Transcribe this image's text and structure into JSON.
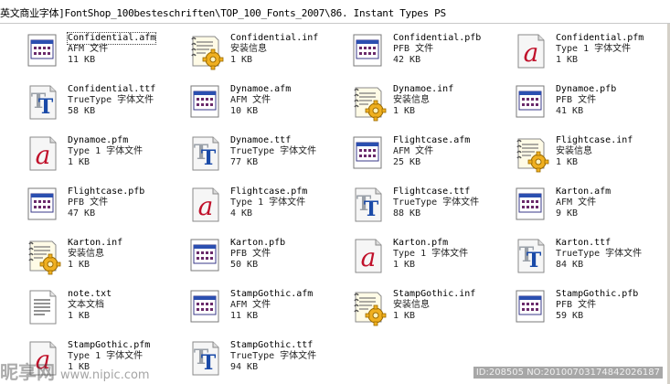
{
  "address": "英文商业字体]FontShop_100besteschriften\\TOP_100_Fonts_2007\\86. Instant Types PS",
  "files": [
    {
      "name": "Confidential.afm",
      "type": "AFM 文件",
      "size": "11 KB",
      "icon": "afm-file-icon"
    },
    {
      "name": "Confidential.inf",
      "type": "安装信息",
      "size": "1 KB",
      "icon": "setup-info-icon"
    },
    {
      "name": "Confidential.pfb",
      "type": "PFB 文件",
      "size": "42 KB",
      "icon": "pfb-file-icon"
    },
    {
      "name": "Confidential.pfm",
      "type": "Type 1 字体文件",
      "size": "1 KB",
      "icon": "type1-font-icon"
    },
    {
      "name": "Confidential.ttf",
      "type": "TrueType 字体文件",
      "size": "58 KB",
      "icon": "truetype-font-icon"
    },
    {
      "name": "Dynamoe.afm",
      "type": "AFM 文件",
      "size": "10 KB",
      "icon": "afm-file-icon"
    },
    {
      "name": "Dynamoe.inf",
      "type": "安装信息",
      "size": "1 KB",
      "icon": "setup-info-icon"
    },
    {
      "name": "Dynamoe.pfb",
      "type": "PFB 文件",
      "size": "41 KB",
      "icon": "pfb-file-icon"
    },
    {
      "name": "Dynamoe.pfm",
      "type": "Type 1 字体文件",
      "size": "1 KB",
      "icon": "type1-font-icon"
    },
    {
      "name": "Dynamoe.ttf",
      "type": "TrueType 字体文件",
      "size": "77 KB",
      "icon": "truetype-font-icon"
    },
    {
      "name": "Flightcase.afm",
      "type": "AFM 文件",
      "size": "25 KB",
      "icon": "afm-file-icon"
    },
    {
      "name": "Flightcase.inf",
      "type": "安装信息",
      "size": "1 KB",
      "icon": "setup-info-icon"
    },
    {
      "name": "Flightcase.pfb",
      "type": "PFB 文件",
      "size": "47 KB",
      "icon": "pfb-file-icon"
    },
    {
      "name": "Flightcase.pfm",
      "type": "Type 1 字体文件",
      "size": "4 KB",
      "icon": "type1-font-icon"
    },
    {
      "name": "Flightcase.ttf",
      "type": "TrueType 字体文件",
      "size": "88 KB",
      "icon": "truetype-font-icon"
    },
    {
      "name": "Karton.afm",
      "type": "AFM 文件",
      "size": "9 KB",
      "icon": "afm-file-icon"
    },
    {
      "name": "Karton.inf",
      "type": "安装信息",
      "size": "1 KB",
      "icon": "setup-info-icon"
    },
    {
      "name": "Karton.pfb",
      "type": "PFB 文件",
      "size": "50 KB",
      "icon": "pfb-file-icon"
    },
    {
      "name": "Karton.pfm",
      "type": "Type 1 字体文件",
      "size": "1 KB",
      "icon": "type1-font-icon"
    },
    {
      "name": "Karton.ttf",
      "type": "TrueType 字体文件",
      "size": "84 KB",
      "icon": "truetype-font-icon"
    },
    {
      "name": "note.txt",
      "type": "文本文档",
      "size": "1 KB",
      "icon": "text-document-icon"
    },
    {
      "name": "StampGothic.afm",
      "type": "AFM 文件",
      "size": "11 KB",
      "icon": "afm-file-icon"
    },
    {
      "name": "StampGothic.inf",
      "type": "安装信息",
      "size": "1 KB",
      "icon": "setup-info-icon"
    },
    {
      "name": "StampGothic.pfb",
      "type": "PFB 文件",
      "size": "59 KB",
      "icon": "pfb-file-icon"
    },
    {
      "name": "StampGothic.pfm",
      "type": "Type 1 字体文件",
      "size": "1 KB",
      "icon": "type1-font-icon"
    },
    {
      "name": "StampGothic.ttf",
      "type": "TrueType 字体文件",
      "size": "94 KB",
      "icon": "truetype-font-icon"
    }
  ],
  "selected_index": 0,
  "watermark": {
    "brand": "昵享网",
    "url": "www.nipic.com",
    "id": "ID:208505 NO:20100703174842026187"
  }
}
